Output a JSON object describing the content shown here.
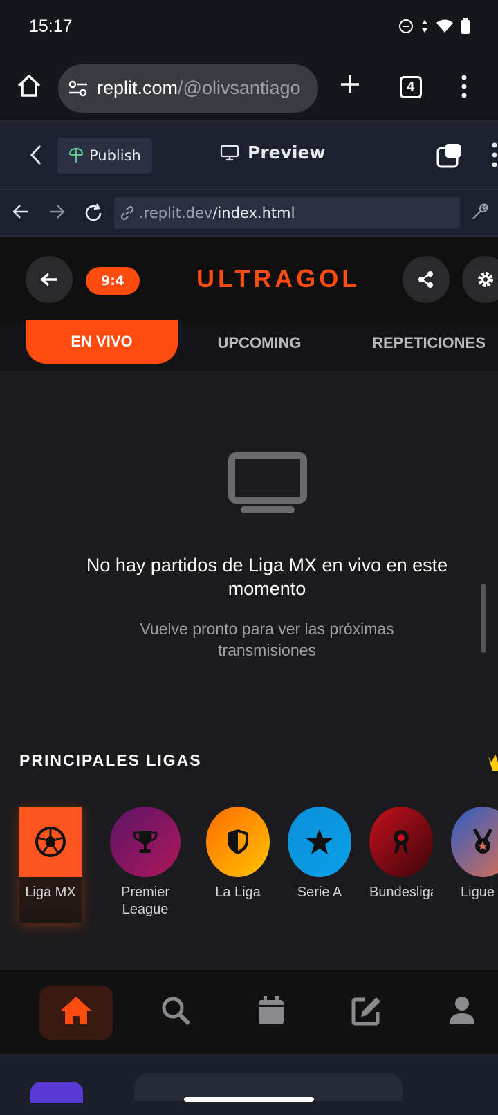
{
  "status": {
    "time": "15:17",
    "icons": [
      "dnd-icon",
      "data-arrows-icon",
      "wifi-icon",
      "battery-icon"
    ]
  },
  "browser": {
    "url_host": "replit.com",
    "url_path": "/@olivsantiago",
    "tab_count": "4"
  },
  "replit": {
    "publish_label": "Publish",
    "preview_label": "Preview",
    "address_host": ".replit.dev",
    "address_path": "/index.html"
  },
  "app": {
    "score_badge": "9:4",
    "logo": "ULTRAGOL",
    "accent": "#ff4a10",
    "tabs": [
      {
        "label": "EN VIVO",
        "active": true
      },
      {
        "label": "UPCOMING",
        "active": false
      },
      {
        "label": "REPETICIONES",
        "active": false
      }
    ],
    "empty_title": "No hay partidos de Liga MX en vivo en este momento",
    "empty_sub": "Vuelve pronto para ver las próximas transmisiones",
    "section_title": "PRINCIPALES LIGAS",
    "leagues": [
      {
        "label": "Liga MX",
        "icon": "soccer-ball-icon",
        "active": true
      },
      {
        "label": "Premier League",
        "icon": "trophy-icon"
      },
      {
        "label": "La Liga",
        "icon": "shield-icon"
      },
      {
        "label": "Serie A",
        "icon": "star-icon"
      },
      {
        "label": "Bundesliga",
        "icon": "award-icon"
      },
      {
        "label": "Ligue",
        "icon": "medal-icon"
      }
    ],
    "bottom_nav": [
      "home-icon",
      "search-icon",
      "calendar-icon",
      "edit-icon",
      "user-icon"
    ]
  }
}
